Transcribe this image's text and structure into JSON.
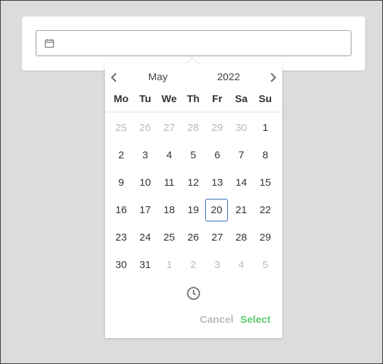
{
  "calendar": {
    "month": "May",
    "year": "2022",
    "weekdays": [
      "Mo",
      "Tu",
      "We",
      "Th",
      "Fr",
      "Sa",
      "Su"
    ],
    "weeks": [
      [
        {
          "d": "25",
          "muted": true
        },
        {
          "d": "26",
          "muted": true
        },
        {
          "d": "27",
          "muted": true
        },
        {
          "d": "28",
          "muted": true
        },
        {
          "d": "29",
          "muted": true
        },
        {
          "d": "30",
          "muted": true
        },
        {
          "d": "1",
          "muted": false
        }
      ],
      [
        {
          "d": "2",
          "muted": false
        },
        {
          "d": "3",
          "muted": false
        },
        {
          "d": "4",
          "muted": false
        },
        {
          "d": "5",
          "muted": false
        },
        {
          "d": "6",
          "muted": false
        },
        {
          "d": "7",
          "muted": false
        },
        {
          "d": "8",
          "muted": false
        }
      ],
      [
        {
          "d": "9",
          "muted": false
        },
        {
          "d": "10",
          "muted": false
        },
        {
          "d": "11",
          "muted": false
        },
        {
          "d": "12",
          "muted": false
        },
        {
          "d": "13",
          "muted": false
        },
        {
          "d": "14",
          "muted": false
        },
        {
          "d": "15",
          "muted": false
        }
      ],
      [
        {
          "d": "16",
          "muted": false
        },
        {
          "d": "17",
          "muted": false
        },
        {
          "d": "18",
          "muted": false
        },
        {
          "d": "19",
          "muted": false
        },
        {
          "d": "20",
          "muted": false,
          "today": true
        },
        {
          "d": "21",
          "muted": false
        },
        {
          "d": "22",
          "muted": false
        }
      ],
      [
        {
          "d": "23",
          "muted": false
        },
        {
          "d": "24",
          "muted": false
        },
        {
          "d": "25",
          "muted": false
        },
        {
          "d": "26",
          "muted": false
        },
        {
          "d": "27",
          "muted": false
        },
        {
          "d": "28",
          "muted": false
        },
        {
          "d": "29",
          "muted": false
        }
      ],
      [
        {
          "d": "30",
          "muted": false
        },
        {
          "d": "31",
          "muted": false
        },
        {
          "d": "1",
          "muted": true
        },
        {
          "d": "2",
          "muted": true
        },
        {
          "d": "3",
          "muted": true
        },
        {
          "d": "4",
          "muted": true
        },
        {
          "d": "5",
          "muted": true
        }
      ]
    ]
  },
  "actions": {
    "cancel_label": "Cancel",
    "select_label": "Select"
  },
  "icons": {
    "input": "calendar-icon",
    "prev": "chevron-left-icon",
    "next": "chevron-right-icon",
    "time": "clock-icon"
  },
  "colors": {
    "today_border": "#2f6db5",
    "select": "#5ecb70",
    "cancel": "#b8bcc2",
    "muted_day": "#b5b9bf"
  }
}
